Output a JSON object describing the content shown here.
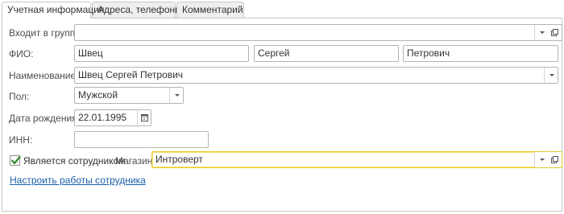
{
  "tabs": [
    {
      "label": "Учетная информация",
      "active": true
    },
    {
      "label": "Адреса, телефоны",
      "active": false
    },
    {
      "label": "Комментарий",
      "active": false
    }
  ],
  "form": {
    "group": {
      "label": "Входит в группу:",
      "value": ""
    },
    "fio": {
      "label": "ФИО:",
      "last_name": "Швец",
      "first_name": "Сергей",
      "middle_name": "Петрович"
    },
    "name": {
      "label": "Наименование:",
      "value": "Швец Сергей Петрович"
    },
    "gender": {
      "label": "Пол:",
      "value": "Мужской"
    },
    "birth_date": {
      "label": "Дата рождения:",
      "value": "22.01.1995"
    },
    "inn": {
      "label": "ИНН:",
      "value": ""
    },
    "employee": {
      "label": "Является сотрудником",
      "checked": true
    },
    "store": {
      "label": "Магазин:",
      "value": "Интроверт"
    },
    "setup_link": "Настроить работы сотрудника"
  },
  "colors": {
    "focus_border": "#e8c92e",
    "link": "#1a60a8",
    "checkmark": "#2e8b2e"
  },
  "icons": {
    "dropdown": "chevron-down-icon",
    "open": "open-form-icon",
    "calendar": "calendar-icon",
    "check": "checkmark-icon"
  }
}
